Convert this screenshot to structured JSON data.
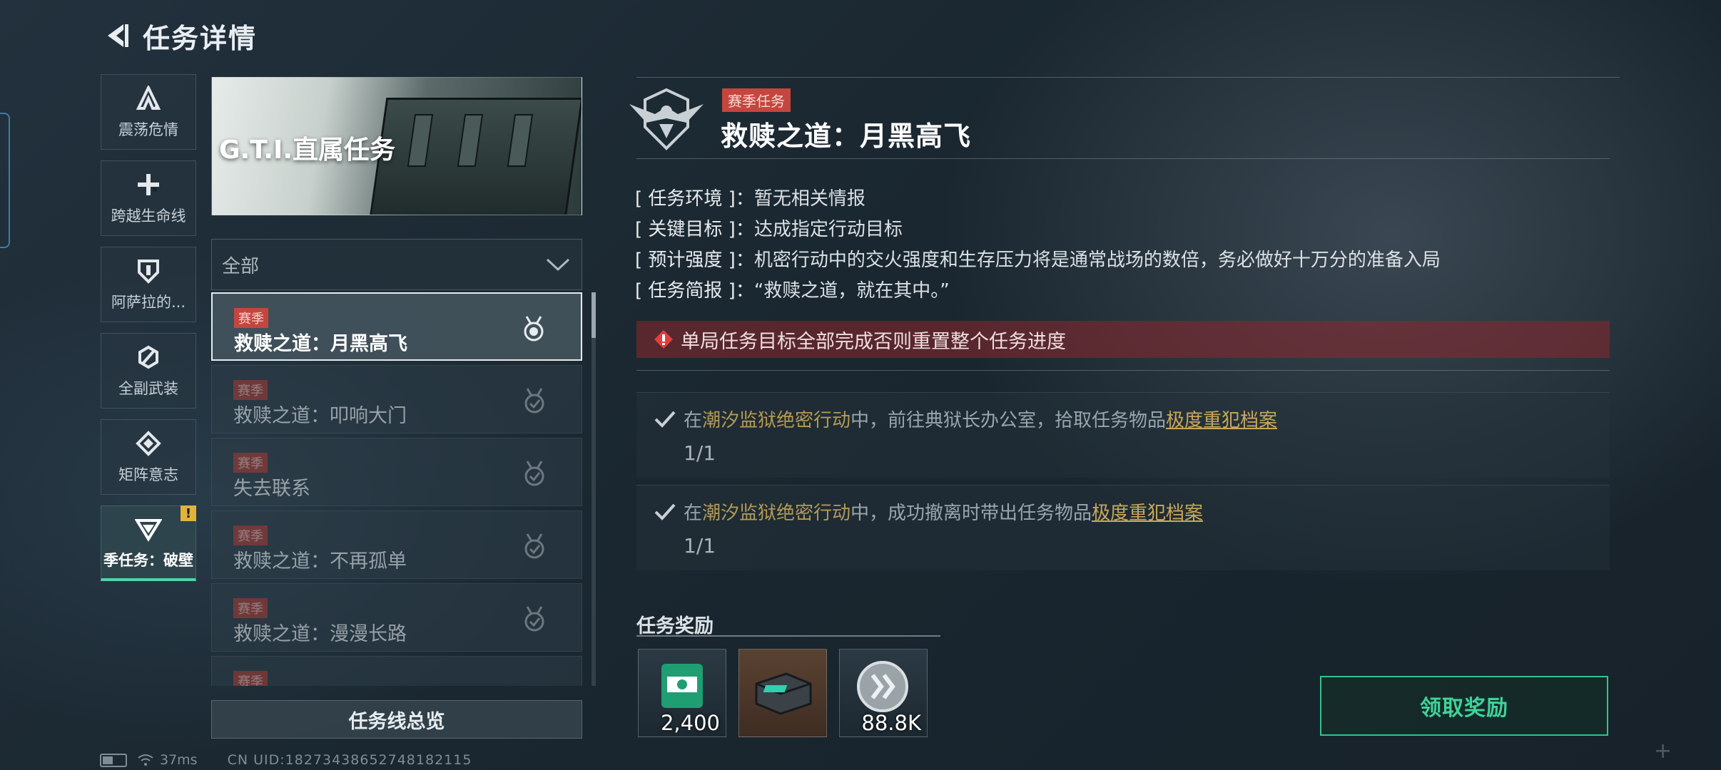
{
  "header": {
    "title": "任务详情"
  },
  "sidebar": {
    "tabs": [
      {
        "label": "震荡危情",
        "icon": "shard-icon"
      },
      {
        "label": "跨越生命线",
        "icon": "crosshair-plus-icon"
      },
      {
        "label": "阿萨拉的...",
        "icon": "shield-icon"
      },
      {
        "label": "全副武装",
        "icon": "ring-slash-icon"
      },
      {
        "label": "矩阵意志",
        "icon": "diamond-icon"
      },
      {
        "label": "季任务：破壁",
        "icon": "triangle-emblem-icon",
        "active": true,
        "badge": "!"
      }
    ]
  },
  "banner": {
    "title": "G.T.I.直属任务"
  },
  "filter": {
    "value": "全部"
  },
  "missions": [
    {
      "tag": "赛季",
      "name": "救赎之道：月黑高飞",
      "selected": true
    },
    {
      "tag": "赛季",
      "name": "救赎之道：叩响大门"
    },
    {
      "tag": "赛季",
      "name": "失去联系"
    },
    {
      "tag": "赛季",
      "name": "救赎之道：不再孤单"
    },
    {
      "tag": "赛季",
      "name": "救赎之道：漫漫长路"
    },
    {
      "tag": "赛季",
      "name": ""
    }
  ],
  "overview_button": "任务线总览",
  "status_bar": {
    "ping": "37ms",
    "uid": "CN UID:18273438652748182115"
  },
  "detail": {
    "tag": "赛季任务",
    "title": "救赎之道：月黑高飞",
    "info": [
      {
        "key": "[ 任务环境 ]：",
        "value": "暂无相关情报"
      },
      {
        "key": "[ 关键目标 ]：",
        "value": "达成指定行动目标"
      },
      {
        "key": "[ 预计强度 ]：",
        "value": "机密行动中的交火强度和生存压力将是通常战场的数倍，务必做好十万分的准备入局"
      },
      {
        "key": "[ 任务简报 ]：",
        "value": "“救赎之道，就在其中。”"
      }
    ],
    "warning": "单局任务目标全部完成否则重置整个任务进度",
    "objectives": [
      {
        "pre": "在",
        "location": "潮汐监狱绝密行动",
        "mid": "中，前往典狱长办公室，拾取任务物品",
        "item": "极度重犯档案",
        "progress": "1/1"
      },
      {
        "pre": "在",
        "location": "潮汐监狱绝密行动",
        "mid": "中，成功撤离时带出任务物品",
        "item": "极度重犯档案",
        "progress": "1/1"
      }
    ]
  },
  "rewards": {
    "title": "任务奖励",
    "items": [
      {
        "icon": "green-badge-icon",
        "qty": "2,400"
      },
      {
        "icon": "crate-icon",
        "qty": ""
      },
      {
        "icon": "silver-coin-icon",
        "qty": "88.8K"
      }
    ]
  },
  "claim_button": "领取奖励",
  "colors": {
    "accent": "#3fd39a",
    "season_tag": "#c4463f",
    "highlight": "#b59a54",
    "warning_bg": "#8c282e"
  }
}
